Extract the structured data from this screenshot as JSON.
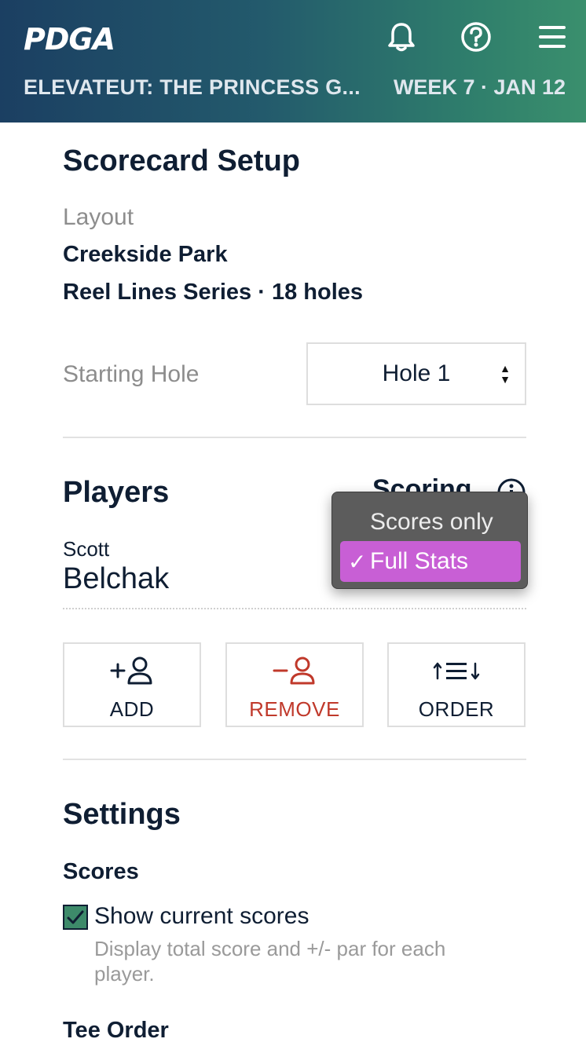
{
  "header": {
    "logo": "PDGA",
    "event_title": "ELEVATEUT: THE PRINCESS G...",
    "event_week": "WEEK 7 · JAN 12",
    "icons": [
      "bell-icon",
      "help-icon",
      "menu-icon"
    ]
  },
  "setup": {
    "title": "Scorecard Setup",
    "layout_label": "Layout",
    "course": "Creekside Park",
    "layout_name": "Reel Lines Series · 18 holes",
    "starting_hole_label": "Starting Hole",
    "starting_hole_value": "Hole 1"
  },
  "players": {
    "title": "Players",
    "scoring_label": "Scoring",
    "list": [
      {
        "first": "Scott",
        "last": "Belchak"
      }
    ],
    "actions": {
      "add": "ADD",
      "remove": "REMOVE",
      "order": "ORDER"
    }
  },
  "scoring_dropdown": {
    "options": [
      "Scores only",
      "Full Stats"
    ],
    "selected": "Full Stats",
    "check": "✓"
  },
  "settings": {
    "title": "Settings",
    "scores_heading": "Scores",
    "show_scores_label": "Show current scores",
    "show_scores_desc": "Display total score and +/- par for each player.",
    "show_scores_checked": true,
    "tee_order_heading": "Tee Order"
  },
  "colors": {
    "brand_dark": "#1b3f62",
    "brand_green": "#3a8f6d",
    "remove_red": "#c0392b",
    "dropdown_highlight": "#c85fd5"
  }
}
